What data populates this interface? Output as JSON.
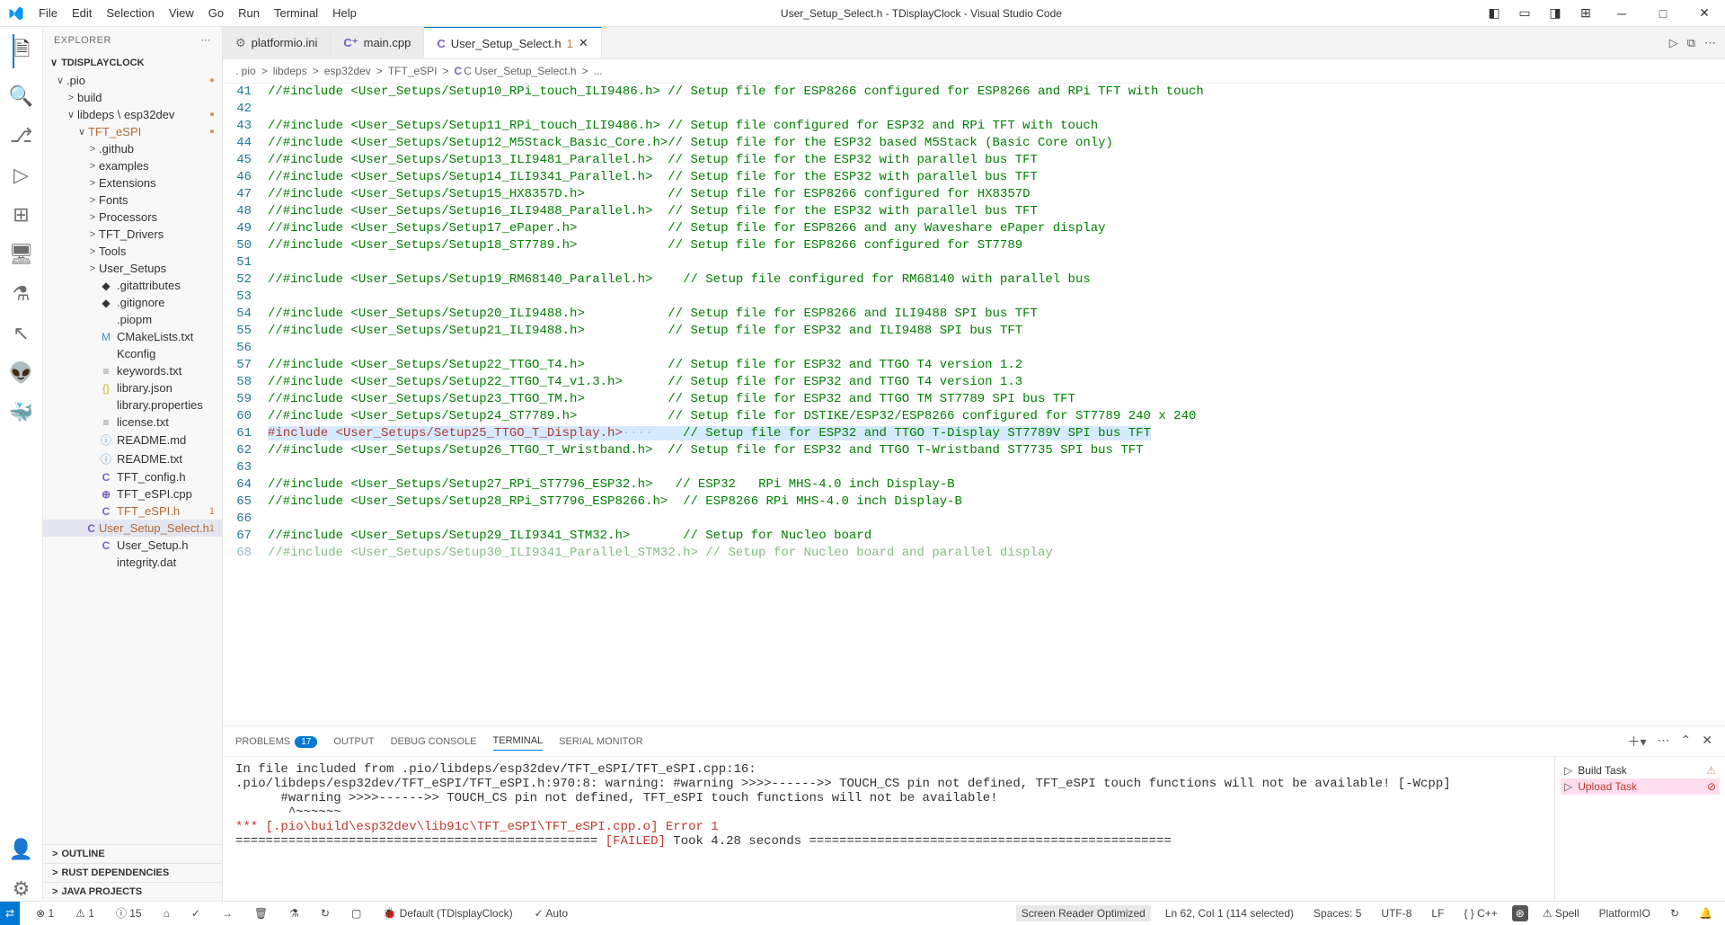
{
  "title": "User_Setup_Select.h - TDisplayClock - Visual Studio Code",
  "menu": [
    "File",
    "Edit",
    "Selection",
    "View",
    "Go",
    "Run",
    "Terminal",
    "Help"
  ],
  "explorer": {
    "title": "EXPLORER",
    "project": "TDISPLAYCLOCK",
    "tree": [
      {
        "indent": 1,
        "chev": "∨",
        "label": ".pio",
        "dot": true
      },
      {
        "indent": 2,
        "chev": ">",
        "label": "build"
      },
      {
        "indent": 2,
        "chev": "∨",
        "label": "libdeps \\ esp32dev",
        "dot": true
      },
      {
        "indent": 3,
        "chev": "∨",
        "label": "TFT_eSPI",
        "dot": true,
        "color": "#b56832"
      },
      {
        "indent": 4,
        "chev": ">",
        "label": ".github"
      },
      {
        "indent": 4,
        "chev": ">",
        "label": "examples"
      },
      {
        "indent": 4,
        "chev": ">",
        "label": "Extensions"
      },
      {
        "indent": 4,
        "chev": ">",
        "label": "Fonts"
      },
      {
        "indent": 4,
        "chev": ">",
        "label": "Processors"
      },
      {
        "indent": 4,
        "chev": ">",
        "label": "TFT_Drivers"
      },
      {
        "indent": 4,
        "chev": ">",
        "label": "Tools"
      },
      {
        "indent": 4,
        "chev": ">",
        "label": "User_Setups"
      },
      {
        "indent": 4,
        "icon": "◆",
        "iconcls": "",
        "label": ".gitattributes"
      },
      {
        "indent": 4,
        "icon": "◆",
        "iconcls": "",
        "label": ".gitignore"
      },
      {
        "indent": 4,
        "icon": "",
        "label": ".piopm"
      },
      {
        "indent": 4,
        "icon": "M",
        "iconcls": "fi-md",
        "label": "CMakeLists.txt"
      },
      {
        "indent": 4,
        "icon": "",
        "label": "Kconfig"
      },
      {
        "indent": 4,
        "icon": "≡",
        "iconcls": "fi-txt",
        "label": "keywords.txt"
      },
      {
        "indent": 4,
        "icon": "{}",
        "iconcls": "fi-json",
        "label": "library.json"
      },
      {
        "indent": 4,
        "icon": "",
        "label": "library.properties"
      },
      {
        "indent": 4,
        "icon": "≡",
        "iconcls": "fi-txt",
        "label": "license.txt"
      },
      {
        "indent": 4,
        "icon": "ⓘ",
        "iconcls": "fi-md",
        "label": "README.md"
      },
      {
        "indent": 4,
        "icon": "ⓘ",
        "iconcls": "fi-md",
        "label": "README.txt"
      },
      {
        "indent": 4,
        "icon": "C",
        "iconcls": "fi-c",
        "label": "TFT_config.h"
      },
      {
        "indent": 4,
        "icon": "⊕",
        "iconcls": "fi-cpp",
        "label": "TFT_eSPI.cpp"
      },
      {
        "indent": 4,
        "icon": "C",
        "iconcls": "fi-c",
        "label": "TFT_eSPI.h",
        "num": "1",
        "color": "#b56832"
      },
      {
        "indent": 4,
        "icon": "C",
        "iconcls": "fi-c",
        "label": "User_Setup_Select.h",
        "num": "1",
        "sel": true,
        "color": "#b56832"
      },
      {
        "indent": 4,
        "icon": "C",
        "iconcls": "fi-c",
        "label": "User_Setup.h"
      },
      {
        "indent": 4,
        "icon": "",
        "label": "integrity.dat"
      }
    ],
    "sections": [
      "OUTLINE",
      "RUST DEPENDENCIES",
      "JAVA PROJECTS"
    ]
  },
  "tabs": [
    {
      "icon": "⚙",
      "label": "platformio.ini",
      "active": false
    },
    {
      "icon": "C⁺",
      "label": "main.cpp",
      "active": false
    },
    {
      "icon": "C",
      "label": "User_Setup_Select.h",
      "suffix": "1",
      "active": true,
      "close": true
    }
  ],
  "breadcrumb": [
    ". pio",
    "libdeps",
    "esp32dev",
    "TFT_eSPI",
    "C User_Setup_Select.h",
    "..."
  ],
  "codeLines": [
    {
      "n": 41,
      "t": "//#include <User_Setups/Setup10_RPi_touch_ILI9486.h> // Setup file for ESP8266 configured for ESP8266 and RPi TFT with touch",
      "cls": "cmt"
    },
    {
      "n": 42,
      "t": "",
      "cls": "cmt"
    },
    {
      "n": 43,
      "t": "//#include <User_Setups/Setup11_RPi_touch_ILI9486.h> // Setup file configured for ESP32 and RPi TFT with touch",
      "cls": "cmt"
    },
    {
      "n": 44,
      "t": "//#include <User_Setups/Setup12_M5Stack_Basic_Core.h>// Setup file for the ESP32 based M5Stack (Basic Core only)",
      "cls": "cmt"
    },
    {
      "n": 45,
      "t": "//#include <User_Setups/Setup13_ILI9481_Parallel.h>  // Setup file for the ESP32 with parallel bus TFT",
      "cls": "cmt"
    },
    {
      "n": 46,
      "t": "//#include <User_Setups/Setup14_ILI9341_Parallel.h>  // Setup file for the ESP32 with parallel bus TFT",
      "cls": "cmt"
    },
    {
      "n": 47,
      "t": "//#include <User_Setups/Setup15_HX8357D.h>           // Setup file for ESP8266 configured for HX8357D",
      "cls": "cmt"
    },
    {
      "n": 48,
      "t": "//#include <User_Setups/Setup16_ILI9488_Parallel.h>  // Setup file for the ESP32 with parallel bus TFT",
      "cls": "cmt"
    },
    {
      "n": 49,
      "t": "//#include <User_Setups/Setup17_ePaper.h>            // Setup file for ESP8266 and any Waveshare ePaper display",
      "cls": "cmt"
    },
    {
      "n": 50,
      "t": "//#include <User_Setups/Setup18_ST7789.h>            // Setup file for ESP8266 configured for ST7789",
      "cls": "cmt"
    },
    {
      "n": 51,
      "t": "",
      "cls": "cmt"
    },
    {
      "n": 52,
      "t": "//#include <User_Setups/Setup19_RM68140_Parallel.h>    // Setup file configured for RM68140 with parallel bus",
      "cls": "cmt"
    },
    {
      "n": 53,
      "t": "",
      "cls": "cmt"
    },
    {
      "n": 54,
      "t": "//#include <User_Setups/Setup20_ILI9488.h>           // Setup file for ESP8266 and ILI9488 SPI bus TFT",
      "cls": "cmt"
    },
    {
      "n": 55,
      "t": "//#include <User_Setups/Setup21_ILI9488.h>           // Setup file for ESP32 and ILI9488 SPI bus TFT",
      "cls": "cmt"
    },
    {
      "n": 56,
      "t": "",
      "cls": "cmt"
    },
    {
      "n": 57,
      "t": "//#include <User_Setups/Setup22_TTGO_T4.h>           // Setup file for ESP32 and TTGO T4 version 1.2",
      "cls": "cmt"
    },
    {
      "n": 58,
      "t": "//#include <User_Setups/Setup22_TTGO_T4_v1.3.h>      // Setup file for ESP32 and TTGO T4 version 1.3",
      "cls": "cmt"
    },
    {
      "n": 59,
      "t": "//#include <User_Setups/Setup23_TTGO_TM.h>           // Setup file for ESP32 and TTGO TM ST7789 SPI bus TFT",
      "cls": "cmt"
    },
    {
      "n": 60,
      "t": "//#include <User_Setups/Setup24_ST7789.h>            // Setup file for DSTIKE/ESP32/ESP8266 configured for ST7789 240 x 240",
      "cls": "cmt"
    },
    {
      "n": 61,
      "pre": "#include <User_Setups/Setup25_TTGO_T_Display.h>",
      "post": "    // Setup file for ESP32 and TTGO T-Display ST7789V SPI bus TFT",
      "hl": true
    },
    {
      "n": 62,
      "t": "//#include <User_Setups/Setup26_TTGO_T_Wristband.h>  // Setup file for ESP32 and TTGO T-Wristband ST7735 SPI bus TFT",
      "cls": "cmt"
    },
    {
      "n": 63,
      "t": "",
      "cls": "cmt"
    },
    {
      "n": 64,
      "t": "//#include <User_Setups/Setup27_RPi_ST7796_ESP32.h>   // ESP32   RPi MHS-4.0 inch Display-B",
      "cls": "cmt"
    },
    {
      "n": 65,
      "t": "//#include <User_Setups/Setup28_RPi_ST7796_ESP8266.h>  // ESP8266 RPi MHS-4.0 inch Display-B",
      "cls": "cmt"
    },
    {
      "n": 66,
      "t": "",
      "cls": "cmt"
    },
    {
      "n": 67,
      "t": "//#include <User_Setups/Setup29_ILI9341_STM32.h>       // Setup for Nucleo board",
      "cls": "cmt"
    },
    {
      "n": 68,
      "t": "//#include <User_Setups/Setup30_ILI9341_Parallel_STM32.h> // Setup for Nucleo board and parallel display",
      "cls": "cmt",
      "dim": true
    }
  ],
  "panel": {
    "tabs": [
      {
        "label": "PROBLEMS",
        "badge": "17"
      },
      {
        "label": "OUTPUT"
      },
      {
        "label": "DEBUG CONSOLE"
      },
      {
        "label": "TERMINAL",
        "active": true
      },
      {
        "label": "SERIAL MONITOR"
      }
    ],
    "terminal": {
      "lines": [
        {
          "cls": "",
          "t": "In file included from .pio/libdeps/esp32dev/TFT_eSPI/TFT_eSPI.cpp:16:"
        },
        {
          "cls": "",
          "t": ".pio/libdeps/esp32dev/TFT_eSPI/TFT_eSPI.h:970:8: warning: #warning >>>>------>> TOUCH_CS pin not defined, TFT_eSPI touch functions will not be available! [-Wcpp]"
        },
        {
          "cls": "",
          "t": "      #warning >>>>------>> TOUCH_CS pin not defined, TFT_eSPI touch functions will not be available!"
        },
        {
          "cls": "",
          "t": "       ^~~~~~~"
        },
        {
          "cls": "err",
          "t": "*** [.pio\\build\\esp32dev\\lib91c\\TFT_eSPI\\TFT_eSPI.cpp.o] Error 1"
        },
        {
          "cls": "",
          "t": "================================================ [FAILED] Took 4.28 seconds ================================================",
          "failwrap": true
        }
      ]
    },
    "tasks": [
      {
        "icon": "▷",
        "label": "Build Task",
        "right": "⚠"
      },
      {
        "icon": "▷",
        "label": "Upload Task",
        "right": "⊘",
        "sel": true
      }
    ]
  },
  "status": {
    "left": [
      "⊗ 1",
      "⚠ 1",
      "ⓘ 15"
    ],
    "items": [
      "⌂",
      "✓",
      "→",
      "🗑",
      "⚗",
      "↻",
      "▢",
      "🐞 Default (TDisplayClock)",
      "✓ Auto"
    ],
    "right": [
      "Screen Reader Optimized",
      "Ln 62, Col 1 (114 selected)",
      "Spaces: 5",
      "UTF-8",
      "LF",
      "{ } C++",
      "⊛",
      "⚠ Spell",
      "PlatformIO",
      "↻",
      "🔔"
    ]
  }
}
